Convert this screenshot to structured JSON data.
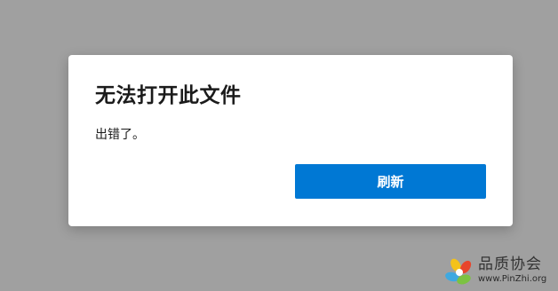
{
  "dialog": {
    "title": "无法打开此文件",
    "message": "出错了。",
    "refresh_label": "刷新"
  },
  "watermark": {
    "title": "品质协会",
    "url": "www.PinZhi.org"
  },
  "colors": {
    "backdrop": "#a0a0a0",
    "dialog_bg": "#ffffff",
    "accent": "#0078d4",
    "text": "#1b1b1b"
  }
}
